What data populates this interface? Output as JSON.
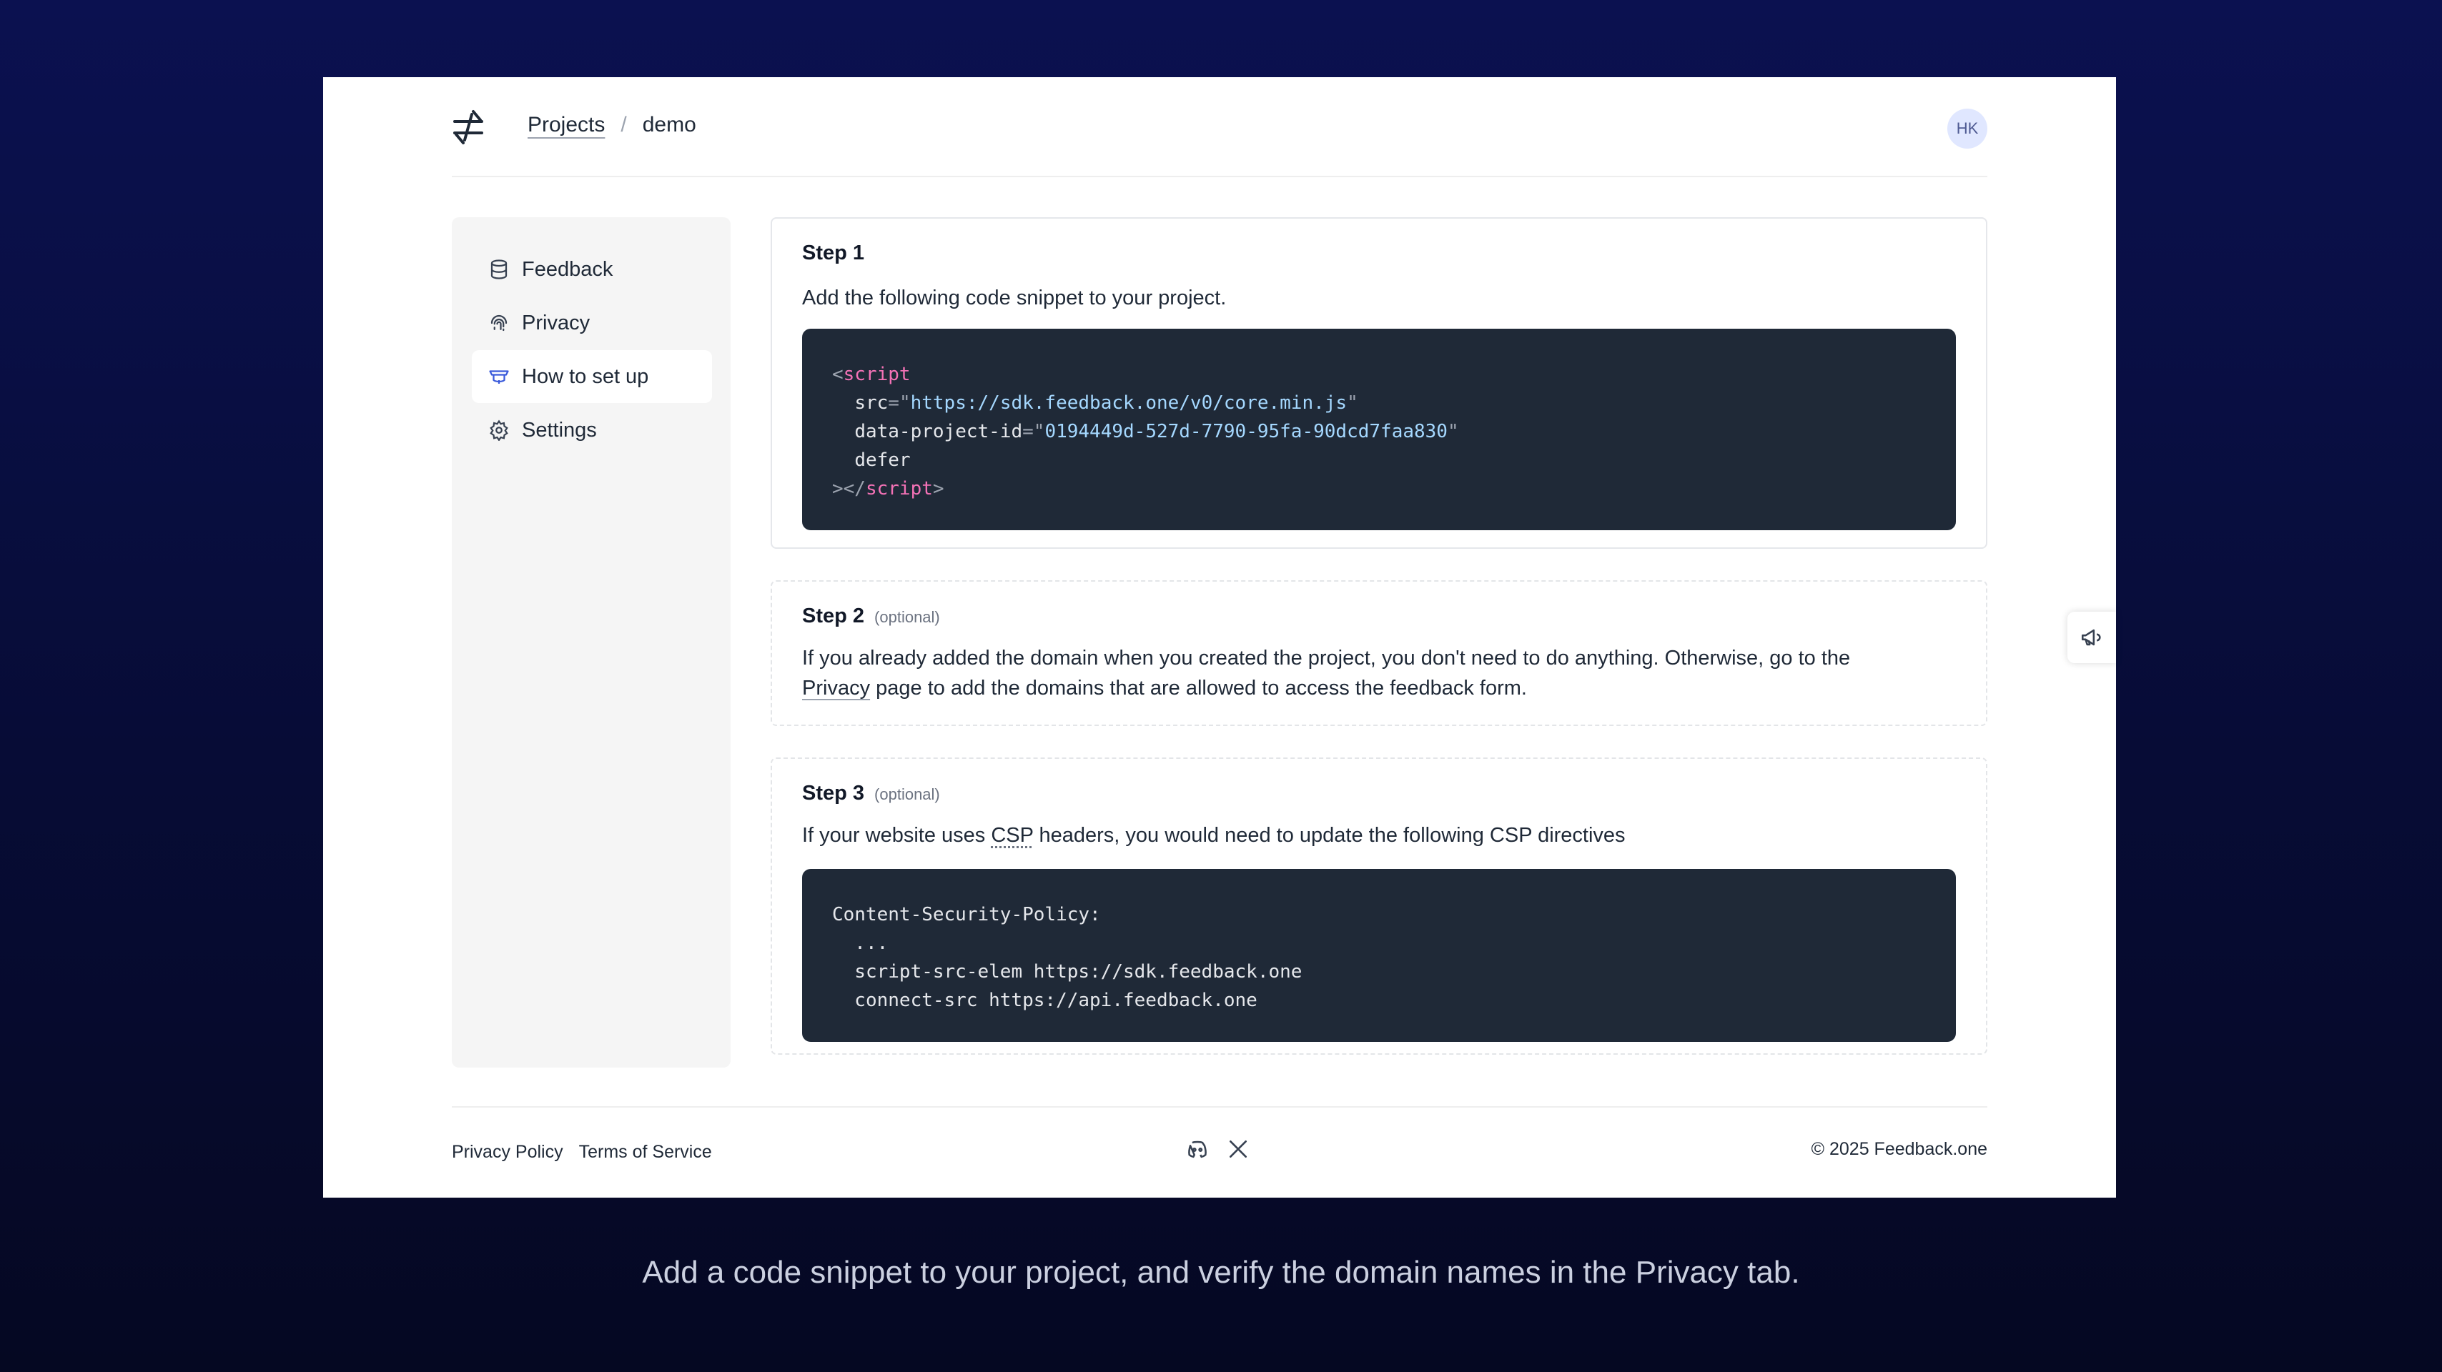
{
  "header": {
    "breadcrumb": {
      "projects": "Projects",
      "separator": "/",
      "current": "demo"
    },
    "avatar_initials": "HK"
  },
  "sidebar": {
    "items": [
      {
        "label": "Feedback",
        "icon": "database-icon",
        "active": false
      },
      {
        "label": "Privacy",
        "icon": "fingerprint-icon",
        "active": false
      },
      {
        "label": "How to set up",
        "icon": "graduation-cap-icon",
        "active": true
      },
      {
        "label": "Settings",
        "icon": "gear-icon",
        "active": false
      }
    ]
  },
  "steps": {
    "step1": {
      "title": "Step 1",
      "text": "Add the following code snippet to your project.",
      "code": {
        "open_lt": "<",
        "tag": "script",
        "src_attr": "src",
        "eq": "=",
        "quote": "\"",
        "src_value": "https://sdk.feedback.one/v0/core.min.js",
        "project_attr": "data-project-id",
        "project_value": "0194449d-527d-7790-95fa-90dcd7faa830",
        "defer": "defer",
        "close_gt": ">",
        "close_open": "</",
        "close_tag": "script",
        "close_end": ">"
      }
    },
    "step2": {
      "title": "Step 2",
      "optional": "(optional)",
      "text_before": "If you already added the domain when you created the project, you don't need to do anything. Otherwise, go to the ",
      "link": "Privacy",
      "text_after": " page to add the domains that are allowed to access the feedback form."
    },
    "step3": {
      "title": "Step 3",
      "optional": "(optional)",
      "text_before": "If your website uses ",
      "abbr": "CSP",
      "text_after": " headers, you would need to update the following CSP directives",
      "code_lines": [
        "Content-Security-Policy:",
        "  ...",
        "  script-src-elem https://sdk.feedback.one",
        "  connect-src https://api.feedback.one"
      ]
    }
  },
  "footer": {
    "privacy_policy": "Privacy Policy",
    "terms": "Terms of Service",
    "copyright": "© 2025 Feedback.one"
  },
  "caption": "Add a code snippet to your project, and verify the domain names in the Privacy tab."
}
